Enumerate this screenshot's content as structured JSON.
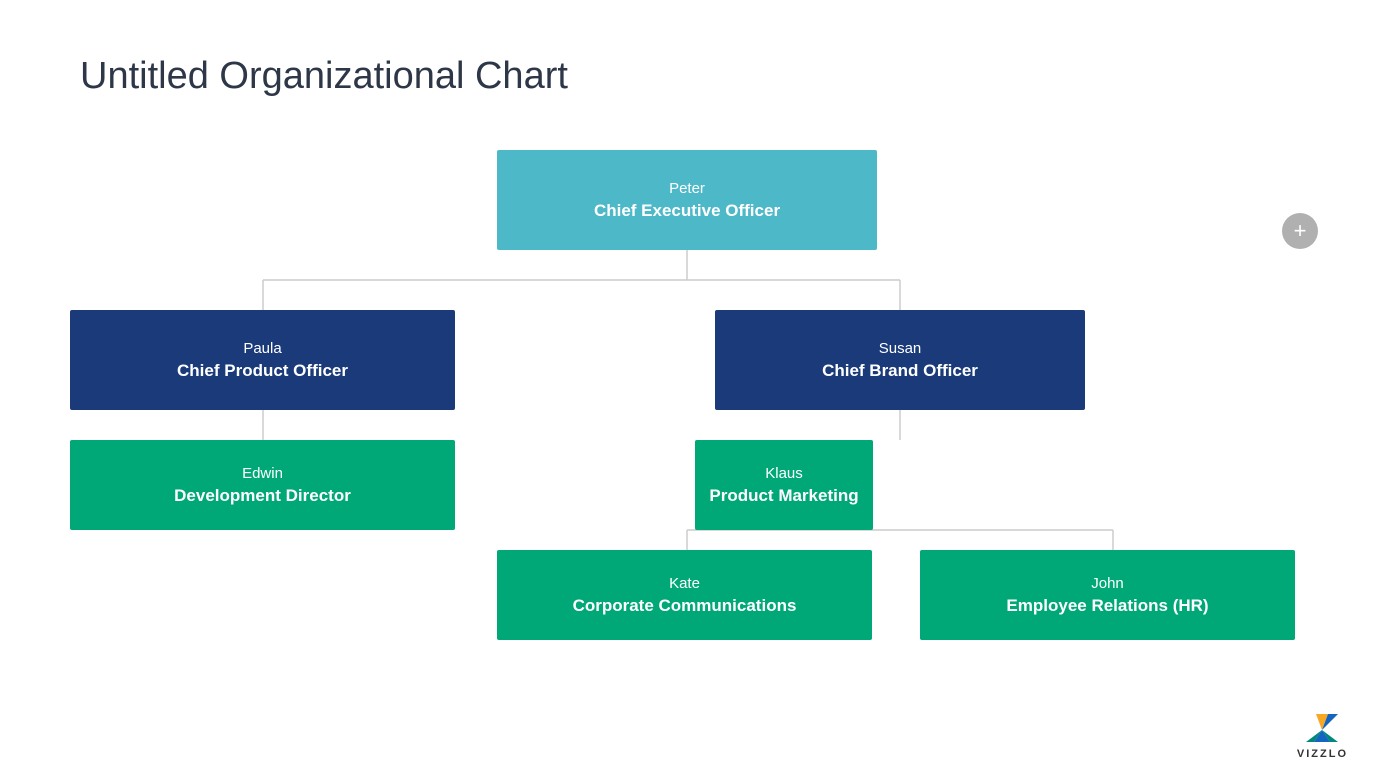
{
  "title": "Untitled Organizational Chart",
  "addButton": "+",
  "nodes": {
    "peter": {
      "name": "Peter",
      "title": "Chief Executive Officer",
      "color": "teal"
    },
    "paula": {
      "name": "Paula",
      "title": "Chief Product Officer",
      "color": "dark-blue"
    },
    "susan": {
      "name": "Susan",
      "title": "Chief Brand Officer",
      "color": "dark-blue"
    },
    "edwin": {
      "name": "Edwin",
      "title": "Development Director",
      "color": "green"
    },
    "klaus": {
      "name": "Klaus",
      "title": "Product Marketing",
      "color": "green"
    },
    "kate": {
      "name": "Kate",
      "title": "Corporate Communications",
      "color": "green"
    },
    "john": {
      "name": "John",
      "title": "Employee Relations (HR)",
      "color": "green"
    }
  },
  "vizzlo": {
    "label": "VIZZLO"
  }
}
